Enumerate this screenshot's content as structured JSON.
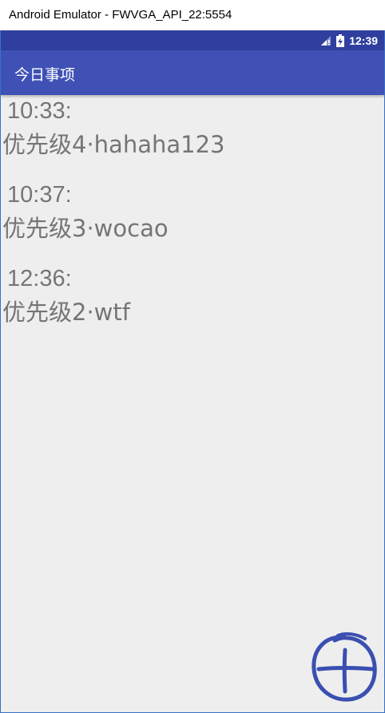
{
  "window": {
    "title": "Android Emulator - FWVGA_API_22:5554"
  },
  "status_bar": {
    "time": "12:39",
    "icons": [
      "signal-icon",
      "battery-charging-icon"
    ],
    "color": "#303f9f"
  },
  "app_bar": {
    "title": "今日事项",
    "color": "#3f51b5"
  },
  "todos": [
    {
      "time": "10:33:",
      "description": "优先级4·hahaha123"
    },
    {
      "time": "10:37:",
      "description": "优先级3·wocao"
    },
    {
      "time": "12:36:",
      "description": "优先级2·wtf"
    }
  ],
  "fab": {
    "icon": "add-icon",
    "color": "#3a4fb0"
  }
}
